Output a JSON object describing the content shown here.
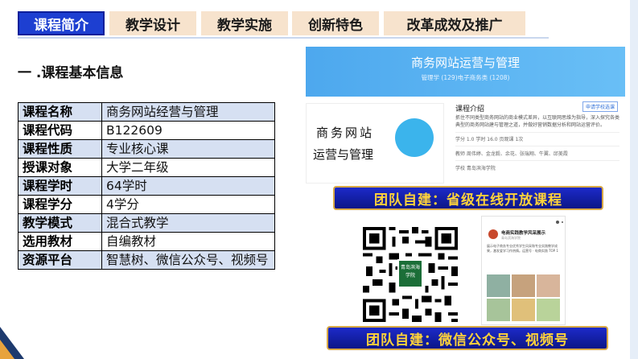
{
  "nav": {
    "tabs": [
      {
        "label": "课程简介",
        "active": true
      },
      {
        "label": "教学设计",
        "active": false
      },
      {
        "label": "教学实施",
        "active": false
      },
      {
        "label": "创新特色",
        "active": false
      },
      {
        "label": "改革成效及推广",
        "active": false
      }
    ]
  },
  "section": {
    "heading": "一 .课程基本信息"
  },
  "info": {
    "rows": [
      {
        "key": "课程名称",
        "value": "商务网站经营与管理"
      },
      {
        "key": "课程代码",
        "value": "B122609"
      },
      {
        "key": "课程性质",
        "value": "专业核心课"
      },
      {
        "key": "授课对象",
        "value": "大学二年级"
      },
      {
        "key": "课程学时",
        "value": "64学时"
      },
      {
        "key": "课程学分",
        "value": "4学分"
      },
      {
        "key": "教学模式",
        "value": "混合式教学"
      },
      {
        "key": "选用教材",
        "value": "自编教材"
      },
      {
        "key": "资源平台",
        "value": "智慧树、微信公众号、视频号"
      }
    ]
  },
  "course_card": {
    "banner_title": "商务网站运营与管理",
    "banner_sub": "管理学 (129)电子商务类 (1208)",
    "cover_line1": "商务网站",
    "cover_line2": "运营与管理",
    "intro_title": "课程介绍",
    "intro_button": "申请学校选课",
    "intro_desc": "抓住不同类型商务网站的商业模式差异，以互联网思维为指导，深入探究各类典型的商务网站建与管理之道，并做好营销数据分析和网站运营评价。",
    "stats": "学分  1.0    学时  16.0    页观课  1次",
    "teachers": "教师  周伟婷、金龙毅、余花、张瑞翔、牛翼、邱美霞",
    "school": "学校  青岛滨海学院"
  },
  "banners": {
    "online_course": "团队自建：省级在线开放课程",
    "wechat": "团队自建：微信公众号、视频号"
  },
  "qr": {
    "logo_text": "青岛滨海学院"
  },
  "phone": {
    "account_name": "电商实践教学风采展示",
    "account_sub": "青岛滨海学院",
    "desc": "展示电子商务专业优秀学生风采和专业实践教学成果，激发爱学习作热情。运营号 · 电商实践 TOP 1"
  },
  "colors": {
    "tab_active_bg": "#1d3fd1",
    "tab_bg": "#f7e3cd",
    "table_shade": "#d6e0f2",
    "banner_bg": "#1d2ac9",
    "banner_text": "#ffd23a",
    "course_banner": "#4da8ee"
  }
}
